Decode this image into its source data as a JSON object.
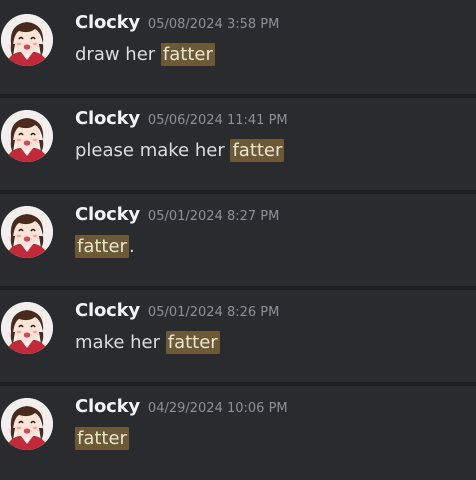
{
  "messages": [
    {
      "author": "Clocky",
      "timestamp": "05/08/2024 3:58 PM",
      "text_before": "draw her ",
      "highlight": "fatter",
      "text_after": ""
    },
    {
      "author": "Clocky",
      "timestamp": "05/06/2024 11:41 PM",
      "text_before": "please make her ",
      "highlight": "fatter",
      "text_after": ""
    },
    {
      "author": "Clocky",
      "timestamp": "05/01/2024 8:27 PM",
      "text_before": "",
      "highlight": "fatter",
      "text_after": "."
    },
    {
      "author": "Clocky",
      "timestamp": "05/01/2024 8:26 PM",
      "text_before": "make her ",
      "highlight": "fatter",
      "text_after": ""
    },
    {
      "author": "Clocky",
      "timestamp": "04/29/2024 10:06 PM",
      "text_before": "",
      "highlight": "fatter",
      "text_after": ""
    }
  ],
  "colors": {
    "background": "#2a2b2f",
    "separator": "#1f2023",
    "username": "#f2f3f5",
    "timestamp": "#8d9096",
    "message_text": "#dcdde0",
    "search_highlight": "#6b5a35"
  },
  "icons": {
    "avatar": "anime-girl-avatar-icon"
  }
}
